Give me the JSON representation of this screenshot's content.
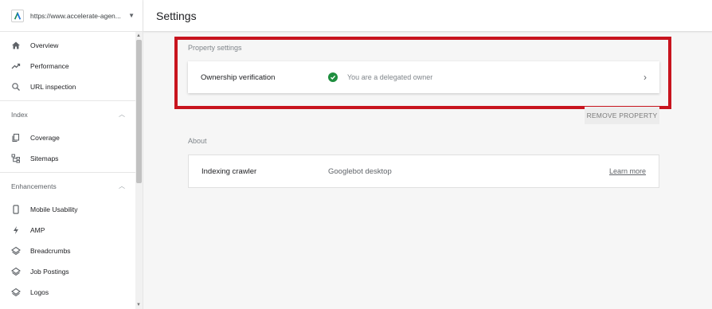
{
  "property": {
    "url": "https://www.accelerate-agen...",
    "logo_icon": "property-logo-icon",
    "accent": "#1a73e8"
  },
  "sidebar": {
    "items_top": [
      {
        "label": "Overview",
        "icon": "home-icon"
      },
      {
        "label": "Performance",
        "icon": "trending-up-icon"
      },
      {
        "label": "URL inspection",
        "icon": "search-icon"
      }
    ],
    "index_section": {
      "title": "Index",
      "items": [
        {
          "label": "Coverage",
          "icon": "copy-icon"
        },
        {
          "label": "Sitemaps",
          "icon": "sitemap-icon"
        }
      ]
    },
    "enhancements_section": {
      "title": "Enhancements",
      "items": [
        {
          "label": "Mobile Usability",
          "icon": "phone-icon"
        },
        {
          "label": "AMP",
          "icon": "bolt-icon"
        },
        {
          "label": "Breadcrumbs",
          "icon": "layers-icon"
        },
        {
          "label": "Job Postings",
          "icon": "layers-icon"
        },
        {
          "label": "Logos",
          "icon": "layers-icon"
        }
      ]
    }
  },
  "header": {
    "title": "Settings"
  },
  "property_settings": {
    "section_label": "Property settings",
    "ownership": {
      "label": "Ownership verification",
      "status": "You are a delegated owner",
      "status_color": "#1e8e3e"
    },
    "remove_button": "REMOVE PROPERTY",
    "highlight_color": "#c8141e"
  },
  "about": {
    "section_label": "About",
    "crawler_label": "Indexing crawler",
    "crawler_value": "Googlebot desktop",
    "learn_more": "Learn more"
  }
}
